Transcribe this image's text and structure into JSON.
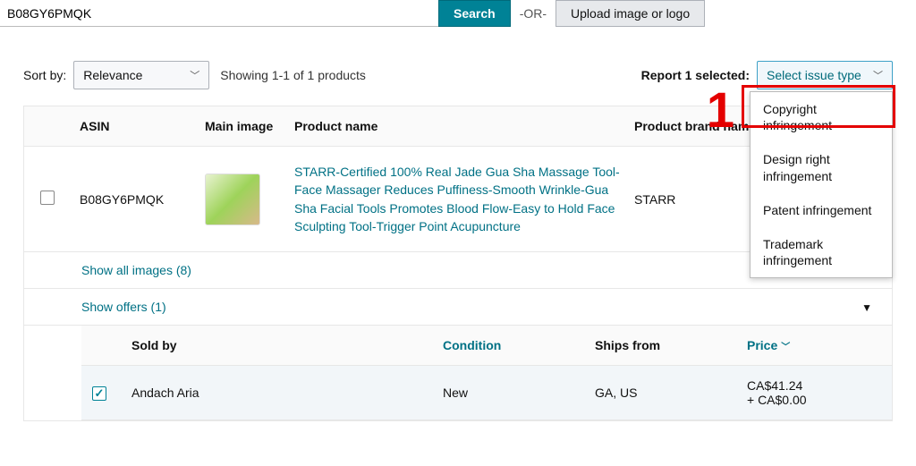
{
  "search": {
    "value": "B08GY6PMQK",
    "button": "Search",
    "or": "-OR-",
    "upload": "Upload image or logo"
  },
  "sort": {
    "label": "Sort by:",
    "value": "Relevance",
    "showing": "Showing 1-1 of 1 products"
  },
  "report": {
    "label": "Report 1 selected:",
    "placeholder": "Select issue type"
  },
  "issue_options": [
    "Copyright infringement",
    "Design right infringement",
    "Patent infringement",
    "Trademark infringement"
  ],
  "annotation": {
    "one": "1"
  },
  "columns": {
    "asin": "ASIN",
    "image": "Main image",
    "name": "Product name",
    "brand": "Product brand name"
  },
  "product": {
    "asin": "B08GY6PMQK",
    "name": "STARR-Certified 100% Real Jade Gua Sha Massage Tool-Face Massager Reduces Puffiness-Smooth Wrinkle-Gua Sha Facial Tools Promotes Blood Flow-Easy to Hold Face Sculpting Tool-Trigger Point Acupuncture",
    "brand": "STARR",
    "show_images": "Show all images (8)",
    "show_offers": "Show offers (1)"
  },
  "offers": {
    "headers": {
      "sold_by": "Sold by",
      "condition": "Condition",
      "ships_from": "Ships from",
      "price": "Price"
    },
    "row": {
      "seller": "Andach Aria",
      "condition": "New",
      "ships_from": "GA, US",
      "price_line1": "CA$41.24",
      "price_line2": "+ CA$0.00"
    }
  }
}
